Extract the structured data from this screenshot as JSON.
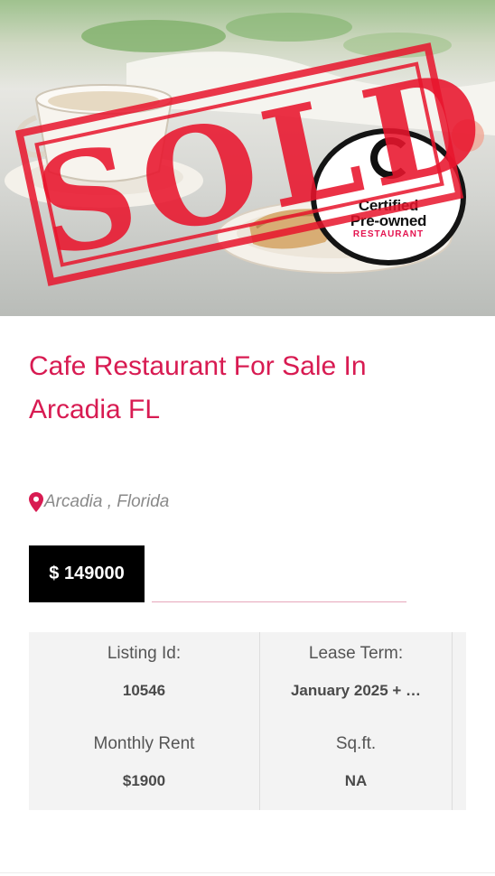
{
  "hero": {
    "stamp_text": "SOLD",
    "badge": {
      "line1": "Certified",
      "line2": "Pre-owned",
      "line3": "RESTAURANT"
    }
  },
  "listing": {
    "title": "Cafe Restaurant For Sale In Arcadia FL",
    "location": "Arcadia , Florida",
    "price": "$ 149000"
  },
  "details": {
    "listing_id_label": "Listing Id:",
    "listing_id_value": "10546",
    "lease_term_label": "Lease Term:",
    "lease_term_value": "January 2025 + …",
    "monthly_rent_label": "Monthly Rent",
    "monthly_rent_value": "$1900",
    "sqft_label": "Sq.ft.",
    "sqft_value": "NA"
  },
  "colors": {
    "accent": "#d81b52",
    "stamp": "#e8142c",
    "price_bg": "#000000",
    "details_bg": "#f3f3f3"
  },
  "icons": {
    "location": "map-pin-icon"
  }
}
